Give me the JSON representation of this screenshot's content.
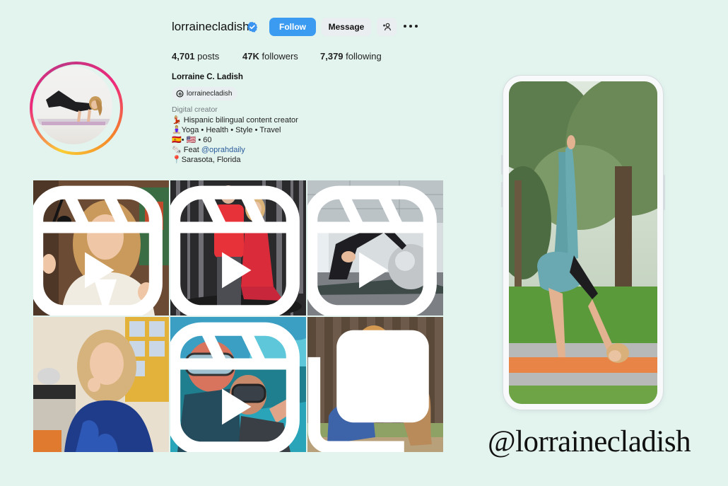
{
  "profile": {
    "username": "lorrainecladish",
    "follow_label": "Follow",
    "message_label": "Message",
    "stats": {
      "posts_count": "4,701",
      "posts_label": "posts",
      "followers_count": "47K",
      "followers_label": "followers",
      "following_count": "7,379",
      "following_label": "following"
    },
    "full_name": "Lorraine C. Ladish",
    "threads_handle": "lorrainecladish",
    "category": "Digital creator",
    "bio": {
      "line1": "💃🏼 Hispanic bilingual content creator",
      "line2": "🧘🏼‍♀️Yoga • Health • Style • Travel",
      "line3": "🇪🇸• 🇺🇸 • 60",
      "line4_prefix": "🗞️ Feat ",
      "line4_link": "@oprahdaily",
      "line5": "📍Sarasota, Florida"
    }
  },
  "grid": {
    "posts": [
      {
        "type": "reel"
      },
      {
        "type": "reel"
      },
      {
        "type": "reel"
      },
      {
        "type": "post"
      },
      {
        "type": "reel"
      },
      {
        "type": "carousel"
      }
    ]
  },
  "caption_handle": "@lorrainecladish",
  "colors": {
    "background": "#e3f3ee",
    "follow_button": "#3b9bf0",
    "link": "#2a5c9a"
  },
  "icons": [
    "verified-badge-icon",
    "add-person-icon",
    "more-options-icon",
    "threads-icon",
    "reel-icon",
    "carousel-icon"
  ]
}
